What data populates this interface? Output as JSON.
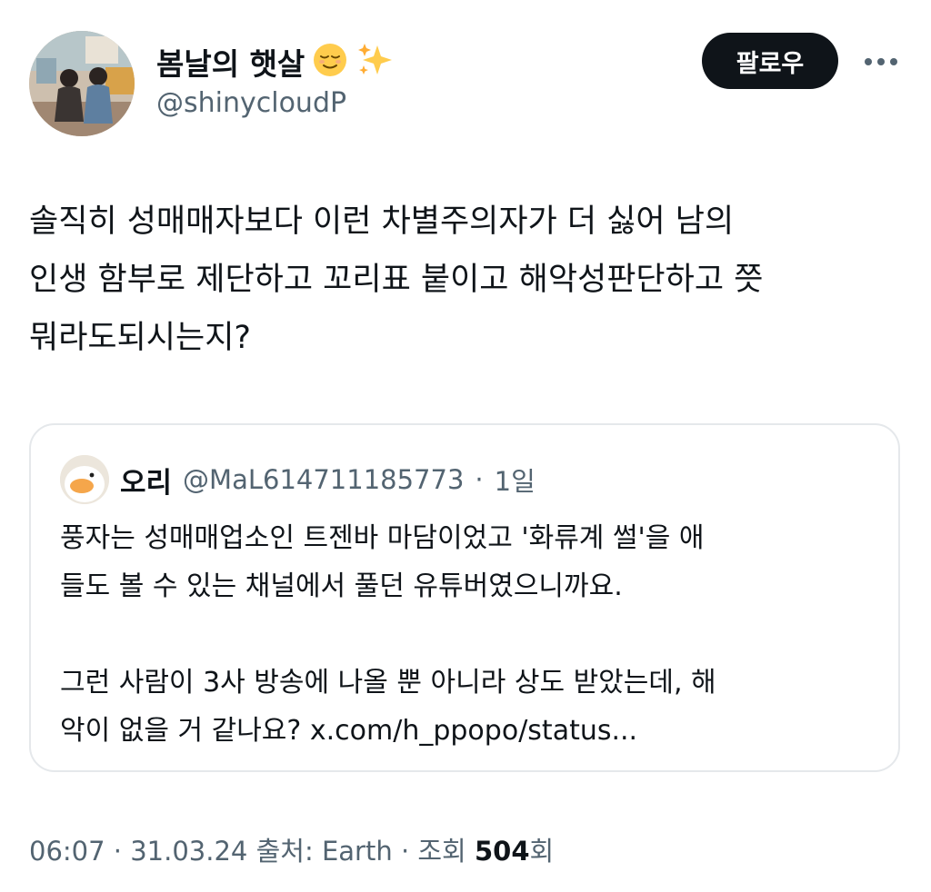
{
  "author": {
    "display_name": "봄날의 햇살",
    "display_name_emojis": [
      "relieved-face",
      "sparkles"
    ],
    "handle": "@shinycloudP"
  },
  "actions": {
    "follow_label": "팔로우",
    "more_icon": "more-horizontal-icon"
  },
  "tweet": {
    "text": "솔직히 성매매자보다 이런 차별주의자가 더 싫어 남의\n인생 함부로 제단하고 꼬리표 붙이고 해악성판단하고 쯧\n뭐라도되시는지?"
  },
  "quote": {
    "display_name": "오리",
    "handle": "@MaL614711185773",
    "separator": "·",
    "time": "1일",
    "text": "풍자는 성매매업소인 트젠바 마담이었고 '화류계 썰'을 애\n들도 볼 수 있는 채널에서 풀던 유튜버였으니까요.\n\n그런 사람이 3사 방송에 나올 뿐 아니라 상도 받았는데, 해\n악이 없을 거 같나요? x.com/h_ppopo/status..."
  },
  "footer": {
    "time": "06:07",
    "date": "31.03.24",
    "source": "출처: Earth",
    "views_label": "조회",
    "views_count": "504",
    "views_suffix": "회",
    "separator": "·"
  },
  "colors": {
    "text_primary": "#0f1419",
    "text_secondary": "#536471",
    "follow_bg": "#0f1419",
    "border": "#e5e8eb"
  }
}
